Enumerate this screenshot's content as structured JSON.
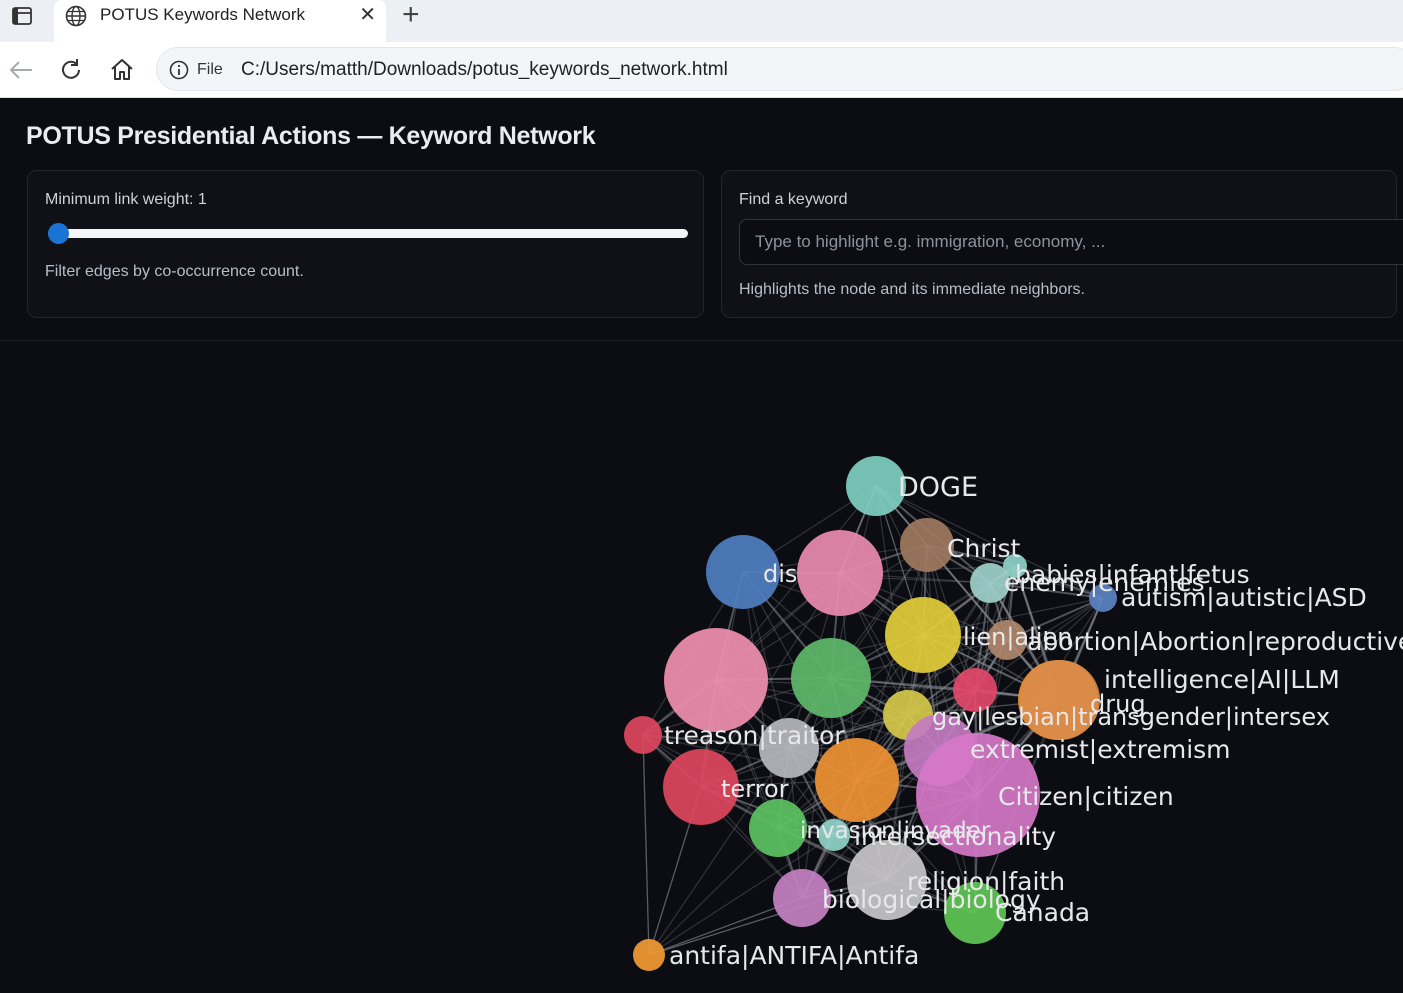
{
  "browser": {
    "tab_title": "POTUS Keywords Network",
    "close_glyph": "✕",
    "new_tab_glyph": "+",
    "file_label": "File",
    "url": "C:/Users/matth/Downloads/potus_keywords_network.html"
  },
  "page": {
    "title": "POTUS Presidential Actions — Keyword Network"
  },
  "controls": {
    "weight_label": "Minimum link weight: 1",
    "weight_value": 1,
    "weight_help": "Filter edges by co-occurrence count.",
    "find_label": "Find a keyword",
    "find_placeholder": "Type to highlight e.g. immigration, economy, ...",
    "find_help": "Highlights the node and its immediate neighbors."
  },
  "colors": {
    "accent": "#1a74d6",
    "edge": "#8c8f96",
    "label": "#e8e8ea"
  },
  "network": {
    "nodes": [
      {
        "id": "doge",
        "label": "DOGE",
        "color": "#7fcfc1"
      },
      {
        "id": "christ",
        "label": "Christ",
        "color": "#a07a5f"
      },
      {
        "id": "unborn",
        "label": "babies|infant|fetus",
        "color": "#8fd3c9"
      },
      {
        "id": "enemy",
        "label": "enemy|enemies",
        "color": "#9ecfca"
      },
      {
        "id": "autism",
        "label": "autism|autistic|ASD",
        "color": "#5b82c2"
      },
      {
        "id": "dis",
        "label": "dis",
        "color": "#4f7ec0"
      },
      {
        "id": "pink1",
        "label": "",
        "color": "#ec8bb0"
      },
      {
        "id": "alien",
        "label": "lien|alien",
        "color": "#e4cd3a"
      },
      {
        "id": "abortion",
        "label": "abortion|Abortion|reproductive",
        "color": "#b0876b"
      },
      {
        "id": "ai",
        "label": "intelligence|AI|LLM",
        "color": "#f0902f"
      },
      {
        "id": "drug",
        "label": "drug",
        "color": "#d98c4a"
      },
      {
        "id": "bigpink",
        "label": "",
        "color": "#f08fb0"
      },
      {
        "id": "green1",
        "label": "",
        "color": "#5fb86a"
      },
      {
        "id": "red1",
        "label": "",
        "color": "#e4486a"
      },
      {
        "id": "gay",
        "label": "gay|lesbian|transgender|intersex",
        "color": "#d6c84a"
      },
      {
        "id": "treason",
        "label": "treason|traitor",
        "color": "#e0465e"
      },
      {
        "id": "grey1",
        "label": "",
        "color": "#b5b7bc"
      },
      {
        "id": "extremism",
        "label": "extremist|extremism",
        "color": "#c37bc1"
      },
      {
        "id": "orange1",
        "label": "",
        "color": "#ef9333"
      },
      {
        "id": "citizen",
        "label": "Citizen|citizen",
        "color": "#d677c8"
      },
      {
        "id": "terror",
        "label": "terror",
        "color": "#e0465e"
      },
      {
        "id": "invasion",
        "label": "invasion|invader",
        "color": "#5cc262"
      },
      {
        "id": "intersect",
        "label": "intersectionality",
        "color": "#8fd3c9"
      },
      {
        "id": "religion",
        "label": "religion|faith",
        "color": "#c8c6c8"
      },
      {
        "id": "biology",
        "label": "biological|biology",
        "color": "#c481c3"
      },
      {
        "id": "canada",
        "label": "Canada",
        "color": "#61c655"
      },
      {
        "id": "antifa",
        "label": "antifa|ANTIFA|Antifa",
        "color": "#f29a32"
      }
    ]
  }
}
